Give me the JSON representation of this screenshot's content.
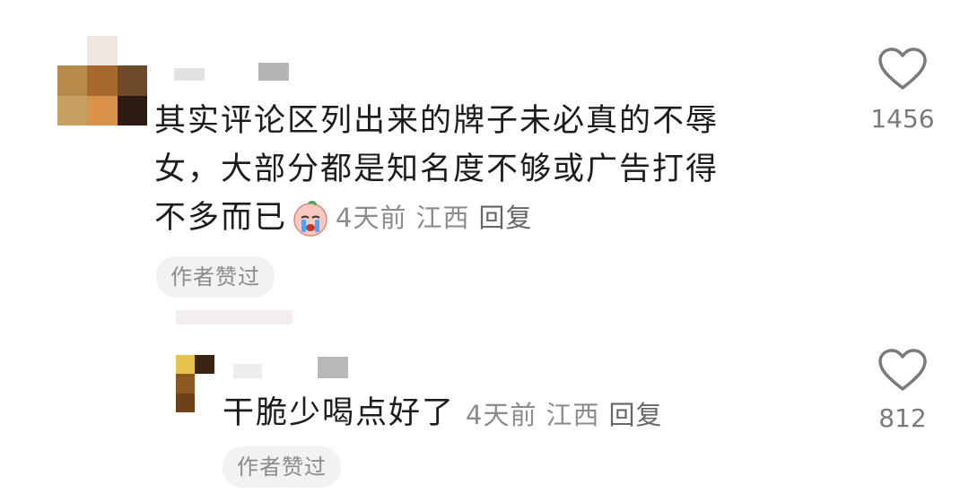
{
  "comments": [
    {
      "text_lines": [
        "其实评论区列出来的牌子未必真的不辱",
        "女，大部分都是知名度不够或广告打得",
        "不多而已"
      ],
      "emoji": "crying-face-emoji",
      "time": "4天前",
      "location": "江西",
      "reply_label": "回复",
      "badge": "作者赞过",
      "likes": "1456"
    },
    {
      "text": "干脆少喝点好了",
      "time": "4天前",
      "location": "江西",
      "reply_label": "回复",
      "badge": "作者赞过",
      "likes": "812"
    }
  ],
  "icons": {
    "like": "heart-outline-icon"
  },
  "colors": {
    "text": "#1c1c1c",
    "meta": "#8c8c8c",
    "badge_bg": "#f2f2f2",
    "icon": "#7a7a7a"
  }
}
